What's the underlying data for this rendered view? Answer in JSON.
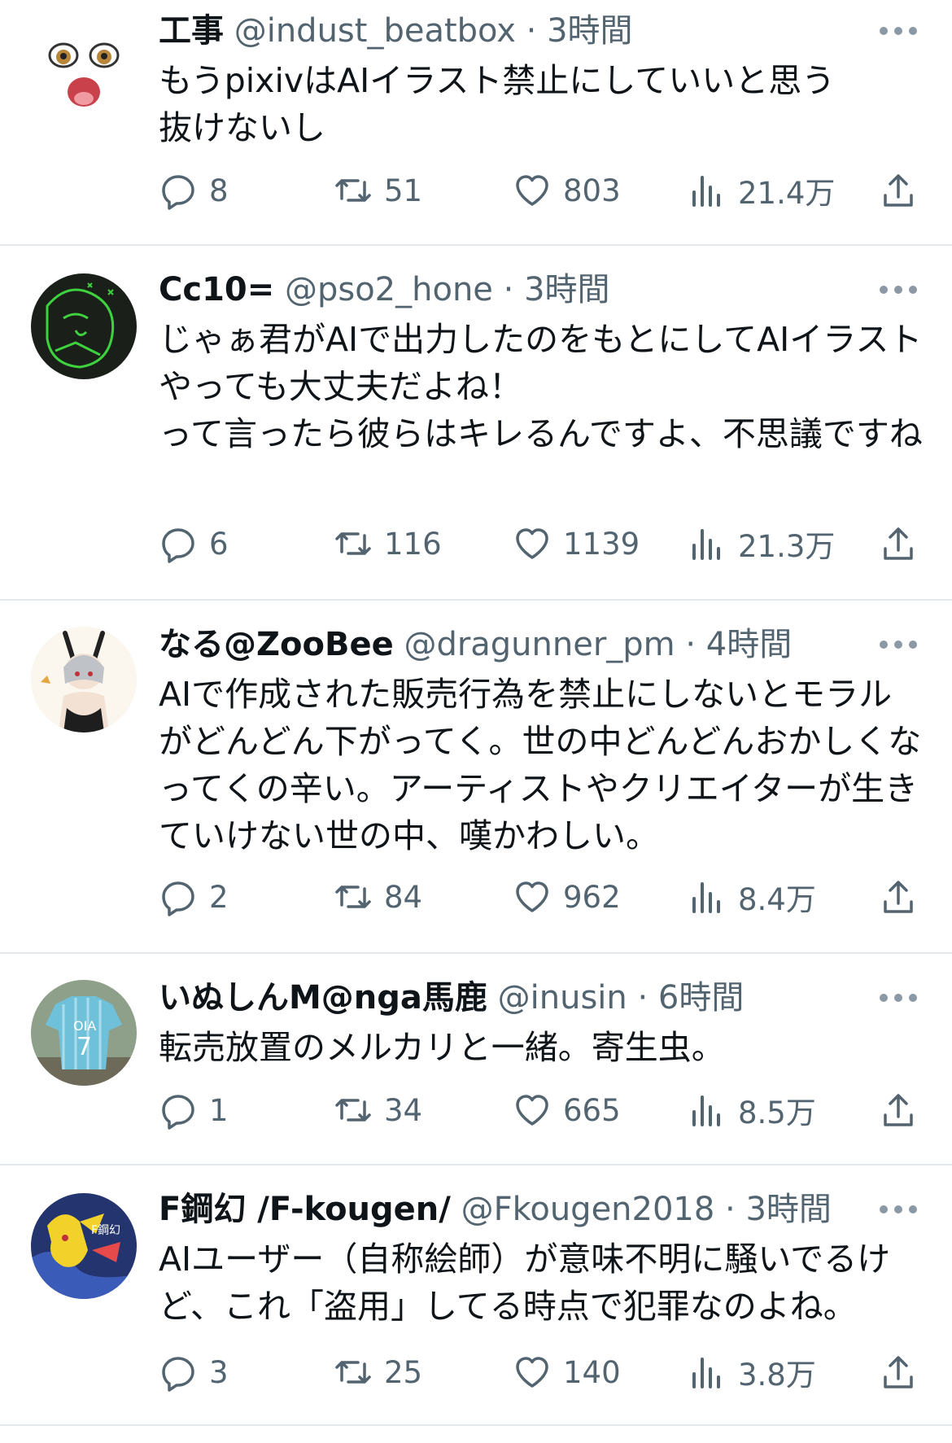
{
  "colors": {
    "text": "#0f1419",
    "secondary": "#536471",
    "divider": "#e6e9ec"
  },
  "tweets": [
    {
      "name": "工事",
      "handle": "@indust_beatbox",
      "dot": "·",
      "time": "3時間",
      "text": "もうpixivはAIイラスト禁止にしていいと思う\n抜けないし",
      "replies": "8",
      "retweets": "51",
      "likes": "803",
      "views": "21.4万",
      "avatar_icon": "anime-face-avatar"
    },
    {
      "name": "Cc10=",
      "handle": "@pso2_hone",
      "dot": "·",
      "time": "3時間",
      "text": "じゃぁ君がAIで出力したのをもとにしてAIイラストやっても大丈夫だよね！\nって言ったら彼らはキレるんですよ、不思議ですね",
      "replies": "6",
      "retweets": "116",
      "likes": "1139",
      "views": "21.3万",
      "avatar_icon": "green-lineart-avatar"
    },
    {
      "name": "なる@ZooBee",
      "handle": "@dragunner_pm",
      "dot": "·",
      "time": "4時間",
      "text": "AIで作成された販売行為を禁止にしないとモラルがどんどん下がってく。世の中どんどんおかしくなってくの辛い。アーティストやクリエイターが生きていけない世の中、嘆かわしい。",
      "replies": "2",
      "retweets": "84",
      "likes": "962",
      "views": "8.4万",
      "avatar_icon": "bunny-girl-avatar"
    },
    {
      "name": "いぬしんM@nga馬鹿",
      "handle": "@inusin",
      "dot": "·",
      "time": "6時間",
      "text": "転売放置のメルカリと一緒。寄生虫。",
      "replies": "1",
      "retweets": "34",
      "likes": "665",
      "views": "8.5万",
      "avatar_icon": "jersey-avatar"
    },
    {
      "name": "F鋼幻 /F-kougen/",
      "handle": "@Fkougen2018",
      "dot": "·",
      "time": "3時間",
      "text": "AIユーザー（自称絵師）が意味不明に騒いでるけど、これ「盗用」してる時点で犯罪なのよね。",
      "replies": "3",
      "retweets": "25",
      "likes": "140",
      "views": "3.8万",
      "avatar_icon": "yellow-character-avatar"
    }
  ]
}
